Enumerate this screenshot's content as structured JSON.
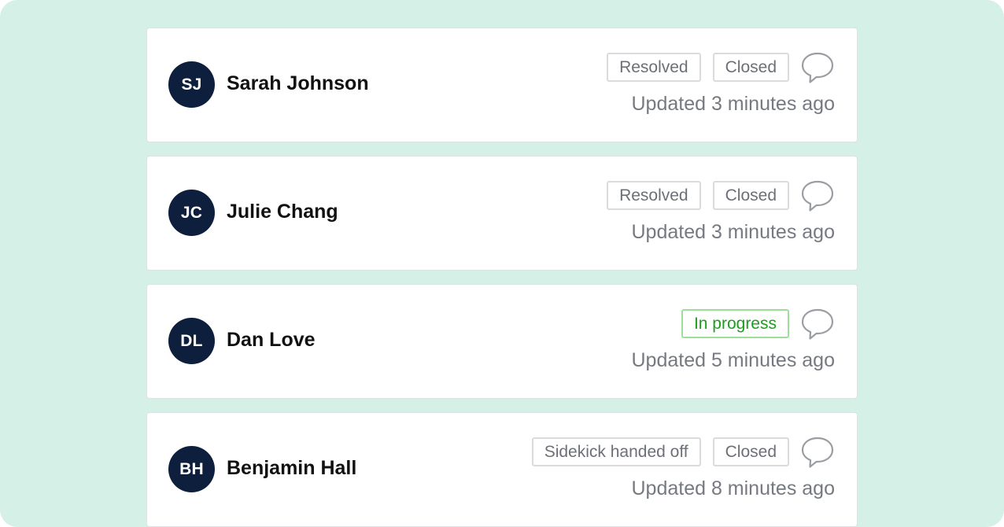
{
  "colors": {
    "background": "#d5f0e6",
    "avatar": "#0e1f3e",
    "in_progress": "#1b9e1b"
  },
  "conversations": [
    {
      "initials": "SJ",
      "name": "Sarah Johnson",
      "badges": [
        {
          "label": "Resolved",
          "style": "neutral"
        },
        {
          "label": "Closed",
          "style": "neutral"
        }
      ],
      "updated": "Updated 3 minutes ago",
      "icon": "chat-bubble-icon"
    },
    {
      "initials": "JC",
      "name": "Julie Chang",
      "badges": [
        {
          "label": "Resolved",
          "style": "neutral"
        },
        {
          "label": "Closed",
          "style": "neutral"
        }
      ],
      "updated": "Updated 3 minutes ago",
      "icon": "chat-bubble-icon"
    },
    {
      "initials": "DL",
      "name": "Dan Love",
      "badges": [
        {
          "label": "In progress",
          "style": "green"
        }
      ],
      "updated": "Updated 5 minutes ago",
      "icon": "chat-bubble-icon"
    },
    {
      "initials": "BH",
      "name": "Benjamin Hall",
      "badges": [
        {
          "label": "Sidekick handed off",
          "style": "neutral"
        },
        {
          "label": "Closed",
          "style": "neutral"
        }
      ],
      "updated": "Updated 8 minutes ago",
      "icon": "chat-bubble-icon"
    }
  ]
}
